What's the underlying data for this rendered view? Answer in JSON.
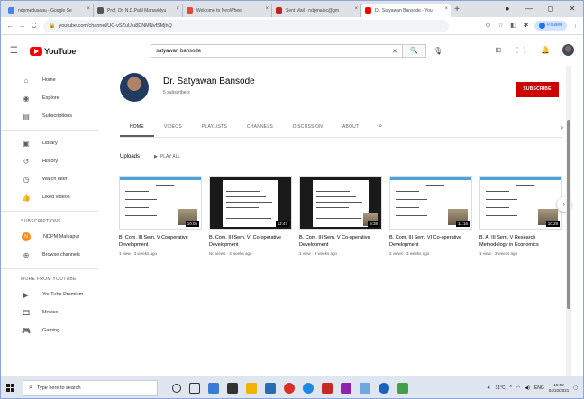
{
  "browser": {
    "tabs": [
      {
        "title": "ndpmedusaau - Google Se",
        "color": "#4285f4"
      },
      {
        "title": "Prof. Dr. N.D.Pahl Mahavidyu",
        "color": "#555555"
      },
      {
        "title": "Welcome to NeoWheel",
        "color": "#e34a3b"
      },
      {
        "title": "Sent Mail - ndpmaipc@gm",
        "color": "#c5221f"
      },
      {
        "title": "Dr. Satyawan Bansode - You",
        "color": "#ff0000"
      }
    ],
    "url": "youtube.com/channel/UC-vSZuUlu8DNMNvfSMjhQ",
    "profile_status": "Paused"
  },
  "youtube": {
    "logo_text": "YouTube",
    "search_value": "satyawan bansode",
    "sidebar": {
      "main": [
        {
          "label": "Home",
          "icon": "home-icon",
          "glyph": "⌂"
        },
        {
          "label": "Explore",
          "icon": "compass-icon",
          "glyph": "◉"
        },
        {
          "label": "Subscriptions",
          "icon": "subscriptions-icon",
          "glyph": "▤"
        }
      ],
      "library": [
        {
          "label": "Library",
          "icon": "library-icon",
          "glyph": "▣"
        },
        {
          "label": "History",
          "icon": "history-icon",
          "glyph": "↺"
        },
        {
          "label": "Watch later",
          "icon": "clock-icon",
          "glyph": "◷"
        },
        {
          "label": "Liked videos",
          "icon": "thumbs-up-icon",
          "glyph": "👍"
        }
      ],
      "subscriptions_heading": "SUBSCRIPTIONS",
      "subscriptions": [
        {
          "label": "NDPM Malkapur",
          "initial": "N"
        },
        {
          "label": "Browse channels",
          "icon": "browse-channels-icon",
          "glyph": "⊕"
        }
      ],
      "more_heading": "MORE FROM YOUTUBE",
      "more": [
        {
          "label": "YouTube Premium",
          "icon": "youtube-premium-icon",
          "glyph": "▶"
        },
        {
          "label": "Movies",
          "icon": "movies-icon",
          "glyph": "🎞"
        },
        {
          "label": "Gaming",
          "icon": "gaming-icon",
          "glyph": "🎮"
        }
      ]
    },
    "channel": {
      "name": "Dr. Satyawan Bansode",
      "subscribers": "5 subscribers",
      "subscribe_label": "SUBSCRIBE",
      "tabs": [
        "HOME",
        "VIDEOS",
        "PLAYLISTS",
        "CHANNELS",
        "DISCUSSION",
        "ABOUT"
      ],
      "section_title": "Uploads",
      "play_all": "PLAY ALL",
      "videos": [
        {
          "title": "B. Com. III Sem. V Cooperative Development",
          "duration": "10:05",
          "meta": "1 view · 3 weeks ago"
        },
        {
          "title": "B. Com. III Sem. VI Co-operative Development",
          "duration": "12:47",
          "meta": "No views · 3 weeks ago"
        },
        {
          "title": "B. Com. III Sem. V Co-operative Development",
          "duration": "9:38",
          "meta": "1 view · 3 weeks ago"
        },
        {
          "title": "B. Com. III Sem. VI Co-operative Development",
          "duration": "11:16",
          "meta": "2 views · 3 weeks ago"
        },
        {
          "title": "B. A. III Sem. V Research Methodology in Economics",
          "duration": "10:29",
          "meta": "1 view · 3 weeks ago"
        }
      ]
    }
  },
  "taskbar": {
    "search_placeholder": "Type here to search",
    "weather": "31°C",
    "lang": "ENG",
    "time": "15:58",
    "date": "04/10/2021"
  }
}
